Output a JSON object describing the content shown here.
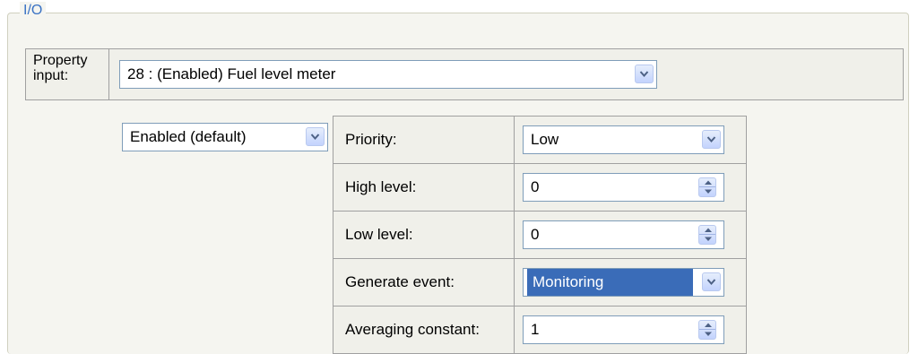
{
  "group": {
    "title": "I/O"
  },
  "property_input": {
    "label_line1": "Property",
    "label_line2": "input:",
    "value": "28 : (Enabled) Fuel level meter"
  },
  "enabled_select": {
    "value": "Enabled (default)"
  },
  "rows": [
    {
      "label": "Priority:",
      "value": "Low",
      "control": "dropdown"
    },
    {
      "label": "High level:",
      "value": "0",
      "control": "spinner"
    },
    {
      "label": "Low level:",
      "value": "0",
      "control": "spinner"
    },
    {
      "label": "Generate event:",
      "value": "Monitoring",
      "control": "dropdown-selected"
    },
    {
      "label": "Averaging constant:",
      "value": "1",
      "control": "spinner"
    }
  ],
  "colors": {
    "accent": "#3a72c4",
    "selection": "#3a6cb8",
    "border": "#a0a0a0",
    "panel": "#f0f0ea"
  }
}
